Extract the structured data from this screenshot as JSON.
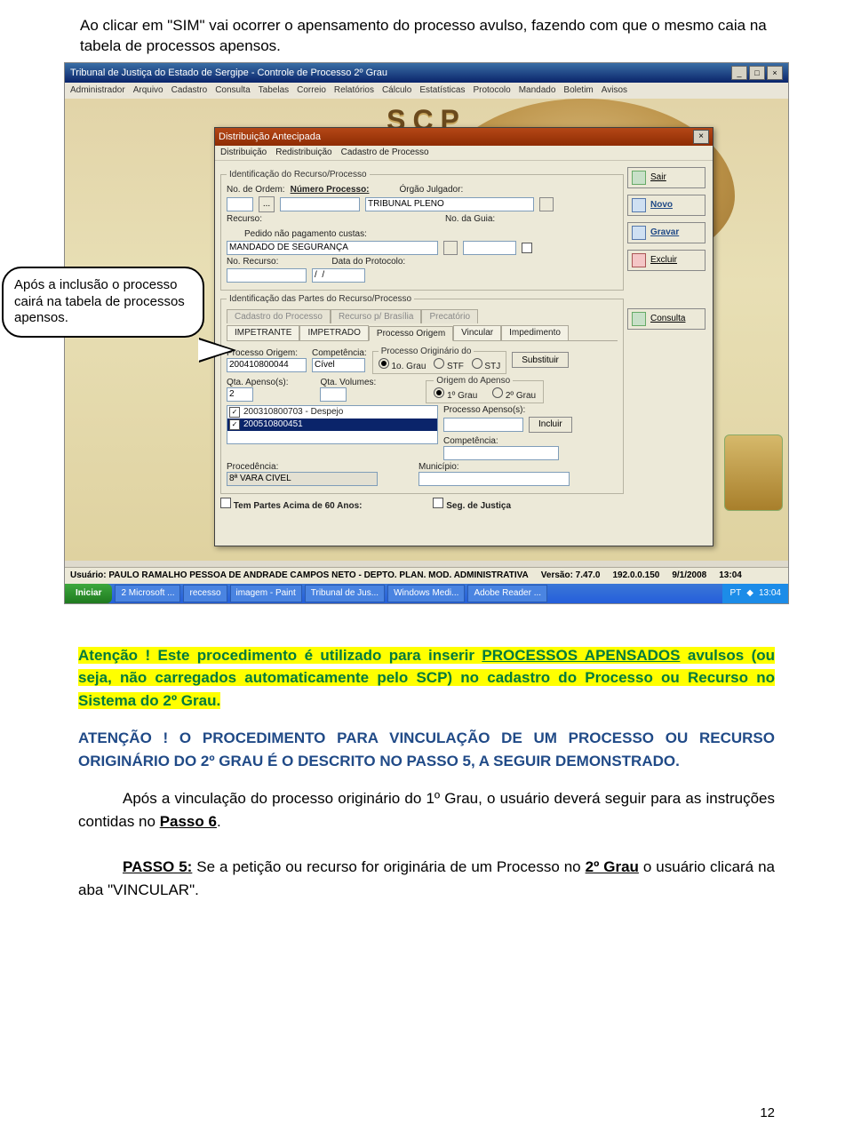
{
  "intro": "Ao clicar em \"SIM\" vai ocorrer o apensamento do processo avulso, fazendo com que o mesmo caia na tabela de processos apensos.",
  "callout": "Após a inclusão o processo cairá na tabela de processos apensos.",
  "window": {
    "title": "Tribunal de Justiça do Estado de Sergipe - Controle de Processo 2º Grau",
    "menu": [
      "Administrador",
      "Arquivo",
      "Cadastro",
      "Consulta",
      "Tabelas",
      "Correio",
      "Relatórios",
      "Cálculo",
      "Estatísticas",
      "Protocolo",
      "Mandado",
      "Boletim",
      "Avisos"
    ],
    "logo": "SCP"
  },
  "status": {
    "user": "Usuário: PAULO RAMALHO PESSOA DE ANDRADE CAMPOS NETO - DEPTO. PLAN. MOD. ADMINISTRATIVA",
    "version": "Versão: 7.47.0",
    "ip": "192.0.0.150",
    "date": "9/1/2008",
    "time": "13:04"
  },
  "taskbar": {
    "start": "Iniciar",
    "items": [
      "2 Microsoft ...",
      "recesso",
      "imagem - Paint",
      "Tribunal de Jus...",
      "Windows Medi...",
      "Adobe Reader ..."
    ],
    "tray_lang": "PT",
    "tray_time": "13:04"
  },
  "modal": {
    "title": "Distribuição Antecipada",
    "menu": [
      "Distribuição",
      "Redistribuição",
      "Cadastro de Processo"
    ],
    "group1": "Identificação do  Recurso/Processo",
    "labels": {
      "ordem": "No. de Ordem:",
      "numproc": "Número Processo:",
      "orgao": "Órgão Julgador:",
      "recurso": "Recurso:",
      "noguia": "No. da Guia:",
      "pedido": "Pedido não pagamento custas:",
      "norecurso": "No. Recurso:",
      "dataprot": "Data do Protocolo:"
    },
    "vals": {
      "orgao": "TRIBUNAL PLENO",
      "recurso": "MANDADO DE SEGURANÇA",
      "dataprot": "/  /"
    },
    "group2": "Identificação das Partes do Recurso/Processo",
    "tabs_top": [
      "Cadastro do Processo",
      "Recurso p/ Brasília",
      "Precatório"
    ],
    "tabs_bottom": [
      "IMPETRANTE",
      "IMPETRADO",
      "Processo Origem",
      "Vincular",
      "Impedimento"
    ],
    "sel_tab": "Processo Origem",
    "proc_origem_lbl": "Processo Origem:",
    "proc_origem_val": "200410800044",
    "compet_lbl": "Competência:",
    "compet_val": "Cível",
    "orig_lbl": "Processo Originário do",
    "orig_opts": [
      "1o. Grau",
      "STF",
      "STJ"
    ],
    "substituir": "Substituir",
    "qta_apenso_lbl": "Qta. Apenso(s):",
    "qta_apenso_val": "2",
    "qta_vol_lbl": "Qta. Volumes:",
    "origem_apenso_lbl": "Origem do Apenso",
    "origem_apenso_opts": [
      "1º Grau",
      "2º Grau"
    ],
    "list": [
      {
        "chk": true,
        "txt": "200310800703 - Despejo"
      },
      {
        "chk": true,
        "txt": "200510800451"
      }
    ],
    "proc_apenso_lbl": "Processo Apenso(s):",
    "incluir": "Incluir",
    "compet2_lbl": "Competência:",
    "proced_lbl": "Procedência:",
    "proced_val": "8ª VARA CÍVEL",
    "munic_lbl": "Município:",
    "chk60": "Tem Partes Acima de 60 Anos:",
    "chkseg": "Seg. de Justiça",
    "side": {
      "sair": "Sair",
      "novo": "Novo",
      "gravar": "Gravar",
      "excluir": "Excluir",
      "consulta": "Consulta"
    }
  },
  "text": {
    "p1_a": "Atenção !",
    "p1_b": " Este procedimento é utilizado para inserir ",
    "p1_c": "PROCESSOS APENSADOS",
    "p1_d": " avulsos (ou seja, não carregados automaticamente pelo SCP) no cadastro do Processo ou Recurso no Sistema do 2º Grau.",
    "p2_a": "ATENÇÃO !",
    "p2_b": " O PROCEDIMENTO PARA VINCULAÇÃO DE UM PROCESSO OU RECURSO ORIGINÁRIO DO 2º GRAU É O DESCRITO NO PASSO 5, A SEGUIR DEMONSTRADO.",
    "p3_a": "Após a vinculação do processo originário do 1º Grau, o usuário deverá seguir para as instruções contidas no ",
    "p3_b": "Passo 6",
    "p3_c": ".",
    "p4_a": "PASSO 5:",
    "p4_b": " Se a petição ou recurso for originária de um Processo no ",
    "p4_c": "2º Grau",
    "p4_d": " o usuário clicará na aba \"VINCULAR\"."
  },
  "pagenum": "12"
}
